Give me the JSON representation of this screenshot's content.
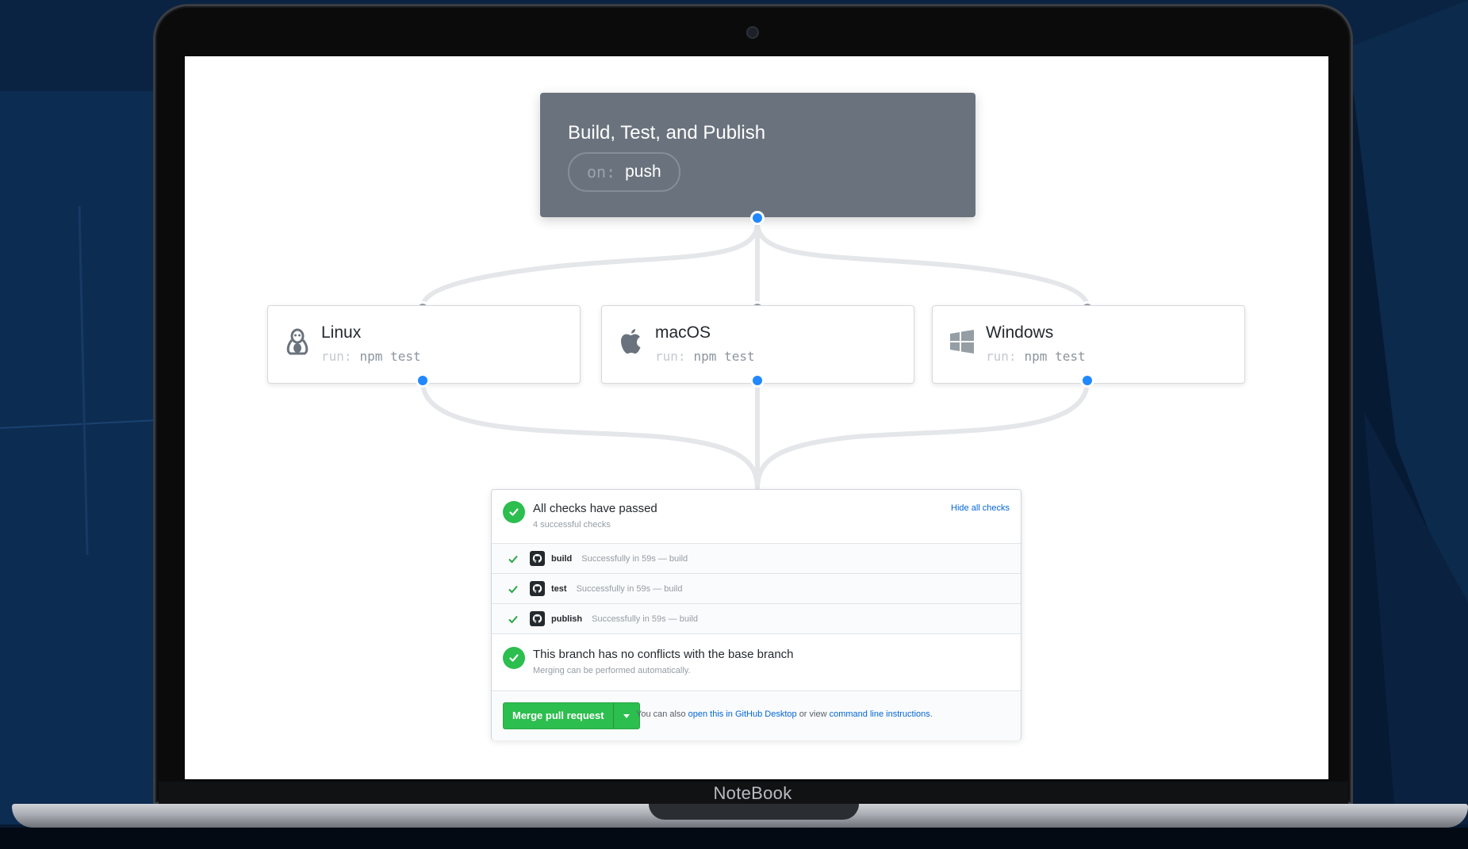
{
  "device": {
    "brand_label": "NoteBook"
  },
  "workflow": {
    "title": "Build, Test, and Publish",
    "trigger_key": "on:",
    "trigger_value": "push"
  },
  "jobs": [
    {
      "name": "Linux",
      "cmd_key": "run:",
      "cmd_value": "npm test",
      "icon": "linux-icon"
    },
    {
      "name": "macOS",
      "cmd_key": "run:",
      "cmd_value": "npm test",
      "icon": "apple-icon"
    },
    {
      "name": "Windows",
      "cmd_key": "run:",
      "cmd_value": "npm test",
      "icon": "windows-icon"
    }
  ],
  "checks": {
    "title": "All checks have passed",
    "subtitle": "4 successful checks",
    "hide_link": "Hide all checks",
    "rows": [
      {
        "name": "build",
        "desc": "Successfully in 59s — build"
      },
      {
        "name": "test",
        "desc": "Successfully in 59s — build"
      },
      {
        "name": "publish",
        "desc": "Successfully in 59s — build"
      }
    ],
    "branch_title": "This branch has no conflicts with the base branch",
    "branch_sub": "Merging can be performed automatically."
  },
  "merge": {
    "button_label": "Merge pull request",
    "hint_prefix": "You can also",
    "desktop_link": "open this in GitHub Desktop",
    "hint_middle": "or view",
    "cli_link": "command line instructions",
    "hint_suffix": "."
  },
  "colors": {
    "background": "#071a33",
    "success": "#2cbe4e",
    "link": "#0366d6",
    "node_active": "#2188ff",
    "trigger_card": "#6a737d"
  }
}
